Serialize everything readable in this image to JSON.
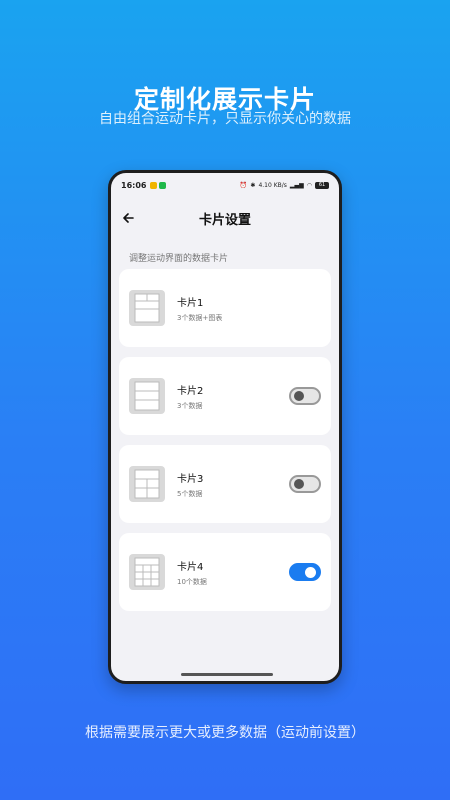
{
  "promo": {
    "headline": "定制化展示卡片",
    "subline": "自由组合运动卡片，只显示你关心的数据",
    "footer": "根据需要展示更大或更多数据（运动前设置）"
  },
  "status_bar": {
    "time": "16:06",
    "net_speed": "4.10 KB/s",
    "battery": "61"
  },
  "screen": {
    "title": "卡片设置",
    "section_label": "调整运动界面的数据卡片",
    "cards": [
      {
        "title": "卡片1",
        "subtitle": "3个数据+图表"
      },
      {
        "title": "卡片2",
        "subtitle": "3个数据",
        "toggle_on": false
      },
      {
        "title": "卡片3",
        "subtitle": "5个数据",
        "toggle_on": false
      },
      {
        "title": "卡片4",
        "subtitle": "10个数据",
        "toggle_on": true
      }
    ]
  },
  "colors": {
    "accent": "#1a7cf0",
    "background_top": "#1aa3f0",
    "background_bottom": "#2f6ef6"
  }
}
